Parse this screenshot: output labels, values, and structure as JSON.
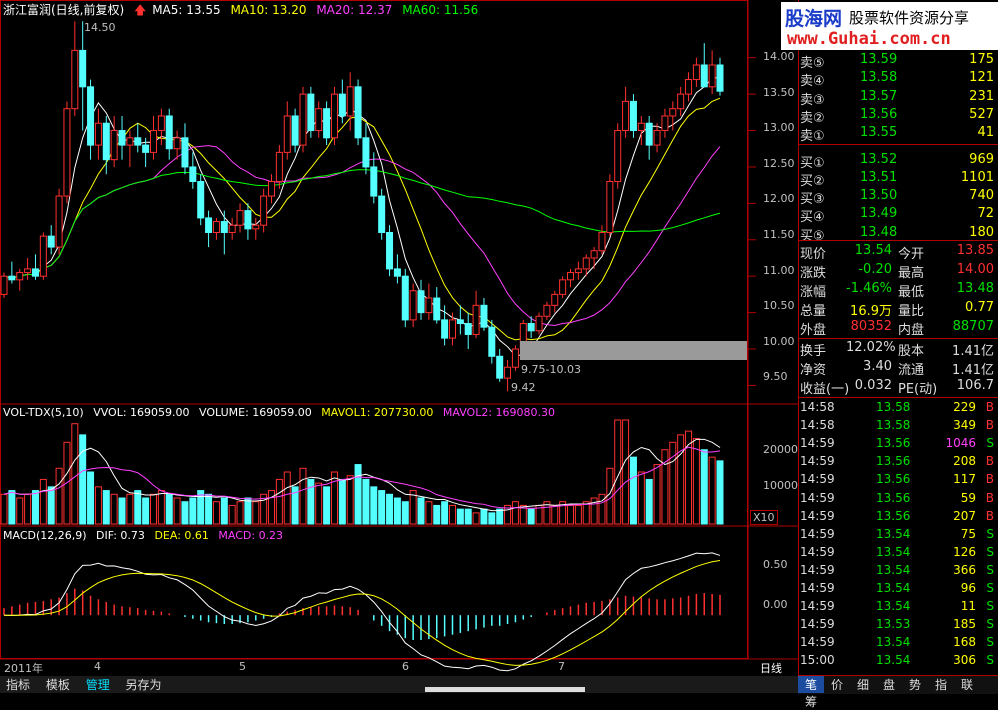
{
  "chart_header": {
    "stock": "浙江富润(日线,前复权)",
    "ma5": "MA5: 13.55",
    "ma10": "MA10: 13.20",
    "ma20": "MA20: 12.37",
    "ma60": "MA60: 11.56"
  },
  "price_annotations": {
    "high": "14.50",
    "low": "9.42",
    "range": "9.75-10.03"
  },
  "price_axis": [
    "14.00",
    "13.50",
    "13.00",
    "12.50",
    "12.00",
    "11.50",
    "11.00",
    "10.50",
    "10.00",
    "9.50"
  ],
  "vol_header": {
    "name": "VOL-TDX(5,10)",
    "vvol": "VVOL: 169059.00",
    "volume": "VOLUME: 169059.00",
    "mavol1": "MAVOL1: 207730.00",
    "mavol2": "MAVOL2: 169080.30"
  },
  "vol_axis": [
    "20000",
    "10000"
  ],
  "vol_unit": "X10",
  "macd_header": {
    "name": "MACD(12,26,9)",
    "dif": "DIF: 0.73",
    "dea": "DEA: 0.61",
    "macd": "MACD: 0.23"
  },
  "macd_axis": [
    "0.50",
    "0.00"
  ],
  "date_axis": [
    "2011年",
    "4",
    "5",
    "6",
    "7"
  ],
  "period_label": "日线",
  "bottom_tabs": [
    "指标",
    "模板",
    "管理",
    "另存为"
  ],
  "bottom_tab_active": 2,
  "watermark": {
    "site": "股海网",
    "slogan": "股票软件资源分享",
    "url": "www.Guhai.com.cn"
  },
  "order_book": {
    "sell": [
      {
        "label": "卖⑤",
        "price": "13.59",
        "vol": "175"
      },
      {
        "label": "卖④",
        "price": "13.58",
        "vol": "121"
      },
      {
        "label": "卖③",
        "price": "13.57",
        "vol": "231"
      },
      {
        "label": "卖②",
        "price": "13.56",
        "vol": "527"
      },
      {
        "label": "卖①",
        "price": "13.55",
        "vol": "41"
      }
    ],
    "buy": [
      {
        "label": "买①",
        "price": "13.52",
        "vol": "969"
      },
      {
        "label": "买②",
        "price": "13.51",
        "vol": "1101"
      },
      {
        "label": "买③",
        "price": "13.50",
        "vol": "740"
      },
      {
        "label": "买④",
        "price": "13.49",
        "vol": "72"
      },
      {
        "label": "买⑤",
        "price": "13.48",
        "vol": "180"
      }
    ]
  },
  "quote": [
    {
      "l1": "现价",
      "v1": "13.54",
      "l2": "今开",
      "v2": "13.85",
      "c1": "#00e000",
      "c2": "#ff3030"
    },
    {
      "l1": "涨跌",
      "v1": "-0.20",
      "l2": "最高",
      "v2": "14.00",
      "c1": "#00e000",
      "c2": "#ff3030"
    },
    {
      "l1": "涨幅",
      "v1": "-1.46%",
      "l2": "最低",
      "v2": "13.48",
      "c1": "#00e000",
      "c2": "#00e000"
    },
    {
      "l1": "总量",
      "v1": "16.9万",
      "l2": "量比",
      "v2": "0.77",
      "c1": "#ffff00",
      "c2": "#ffff00"
    },
    {
      "l1": "外盘",
      "v1": "80352",
      "l2": "内盘",
      "v2": "88707",
      "c1": "#ff3030",
      "c2": "#00e000"
    }
  ],
  "fundamentals": [
    {
      "l1": "换手",
      "v1": "12.02%",
      "l2": "股本",
      "v2": "1.41亿"
    },
    {
      "l1": "净资",
      "v1": "3.40",
      "l2": "流通",
      "v2": "1.41亿"
    },
    {
      "l1": "收益(一)",
      "v1": "0.032",
      "l2": "PE(动)",
      "v2": "106.7"
    }
  ],
  "ticks": [
    {
      "t": "14:58",
      "p": "13.58",
      "v": "229",
      "s": "B"
    },
    {
      "t": "14:58",
      "p": "13.58",
      "v": "349",
      "s": "B"
    },
    {
      "t": "14:59",
      "p": "13.56",
      "v": "1046",
      "s": "S"
    },
    {
      "t": "14:59",
      "p": "13.56",
      "v": "208",
      "s": "B"
    },
    {
      "t": "14:59",
      "p": "13.56",
      "v": "117",
      "s": "B"
    },
    {
      "t": "14:59",
      "p": "13.56",
      "v": "59",
      "s": "B"
    },
    {
      "t": "14:59",
      "p": "13.56",
      "v": "207",
      "s": "B"
    },
    {
      "t": "14:59",
      "p": "13.54",
      "v": "75",
      "s": "S"
    },
    {
      "t": "14:59",
      "p": "13.54",
      "v": "126",
      "s": "S"
    },
    {
      "t": "14:59",
      "p": "13.54",
      "v": "366",
      "s": "S"
    },
    {
      "t": "14:59",
      "p": "13.54",
      "v": "96",
      "s": "S"
    },
    {
      "t": "14:59",
      "p": "13.54",
      "v": "11",
      "s": "S"
    },
    {
      "t": "14:59",
      "p": "13.53",
      "v": "185",
      "s": "S"
    },
    {
      "t": "14:59",
      "p": "13.54",
      "v": "168",
      "s": "S"
    },
    {
      "t": "15:00",
      "p": "13.54",
      "v": "306",
      "s": "S"
    }
  ],
  "bottom_toolbar": [
    "笔",
    "价",
    "细",
    "盘",
    "势",
    "指",
    "联",
    "筹"
  ],
  "bottom_toolbar_active": 0,
  "chart_data": {
    "type": "candlestick",
    "candles": [
      [
        10.75,
        11.05,
        10.7,
        11.0
      ],
      [
        11.0,
        11.2,
        10.9,
        10.95
      ],
      [
        10.95,
        11.1,
        10.8,
        11.05
      ],
      [
        11.05,
        11.25,
        10.95,
        11.1
      ],
      [
        11.1,
        11.3,
        10.95,
        11.0
      ],
      [
        11.0,
        11.6,
        10.95,
        11.55
      ],
      [
        11.55,
        11.7,
        11.3,
        11.4
      ],
      [
        11.4,
        12.2,
        11.3,
        12.1
      ],
      [
        12.1,
        13.4,
        12.0,
        13.3
      ],
      [
        13.3,
        14.5,
        13.2,
        14.1
      ],
      [
        14.1,
        14.5,
        13.0,
        13.6
      ],
      [
        13.6,
        13.7,
        12.6,
        12.8
      ],
      [
        12.8,
        13.3,
        12.6,
        13.1
      ],
      [
        13.1,
        13.2,
        12.4,
        12.6
      ],
      [
        12.6,
        13.2,
        12.5,
        13.0
      ],
      [
        13.0,
        13.2,
        12.6,
        12.8
      ],
      [
        12.8,
        13.0,
        12.5,
        12.9
      ],
      [
        12.9,
        13.1,
        12.7,
        12.8
      ],
      [
        12.8,
        12.9,
        12.5,
        12.7
      ],
      [
        12.7,
        13.2,
        12.6,
        13.0
      ],
      [
        13.0,
        13.3,
        12.8,
        13.2
      ],
      [
        13.2,
        13.3,
        12.6,
        12.75
      ],
      [
        12.75,
        13.0,
        12.6,
        12.9
      ],
      [
        12.9,
        13.1,
        12.4,
        12.5
      ],
      [
        12.5,
        12.7,
        12.2,
        12.3
      ],
      [
        12.3,
        12.4,
        11.7,
        11.8
      ],
      [
        11.8,
        11.9,
        11.4,
        11.6
      ],
      [
        11.6,
        11.8,
        11.5,
        11.75
      ],
      [
        11.75,
        11.9,
        11.3,
        11.6
      ],
      [
        11.6,
        11.8,
        11.5,
        11.7
      ],
      [
        11.7,
        12.0,
        11.6,
        11.9
      ],
      [
        11.9,
        12.0,
        11.5,
        11.65
      ],
      [
        11.65,
        11.8,
        11.5,
        11.7
      ],
      [
        11.7,
        12.2,
        11.6,
        12.1
      ],
      [
        12.1,
        12.4,
        12.0,
        12.3
      ],
      [
        12.3,
        12.8,
        12.2,
        12.7
      ],
      [
        12.7,
        13.4,
        12.6,
        13.2
      ],
      [
        13.2,
        13.3,
        12.7,
        12.8
      ],
      [
        12.8,
        13.6,
        12.7,
        13.5
      ],
      [
        13.5,
        13.6,
        12.9,
        13.0
      ],
      [
        13.0,
        13.4,
        12.9,
        13.3
      ],
      [
        13.3,
        13.4,
        12.8,
        12.9
      ],
      [
        12.9,
        13.6,
        12.8,
        13.5
      ],
      [
        13.5,
        13.7,
        13.1,
        13.2
      ],
      [
        13.2,
        13.8,
        13.0,
        13.6
      ],
      [
        13.6,
        13.7,
        12.8,
        12.9
      ],
      [
        12.9,
        13.1,
        12.4,
        12.5
      ],
      [
        12.5,
        12.7,
        12.0,
        12.1
      ],
      [
        12.1,
        12.2,
        11.5,
        11.6
      ],
      [
        11.6,
        11.7,
        11.0,
        11.1
      ],
      [
        11.1,
        11.3,
        10.9,
        11.0
      ],
      [
        11.0,
        11.1,
        10.3,
        10.4
      ],
      [
        10.4,
        10.9,
        10.3,
        10.8
      ],
      [
        10.8,
        10.95,
        10.4,
        10.5
      ],
      [
        10.5,
        10.9,
        10.4,
        10.7
      ],
      [
        10.7,
        10.85,
        10.35,
        10.4
      ],
      [
        10.4,
        10.6,
        10.05,
        10.15
      ],
      [
        10.15,
        10.5,
        10.05,
        10.4
      ],
      [
        10.4,
        10.6,
        10.2,
        10.35
      ],
      [
        10.35,
        10.5,
        10.0,
        10.2
      ],
      [
        10.2,
        10.8,
        10.15,
        10.6
      ],
      [
        10.6,
        10.7,
        10.25,
        10.3
      ],
      [
        10.3,
        10.4,
        9.8,
        9.9
      ],
      [
        9.9,
        10.0,
        9.55,
        9.6
      ],
      [
        9.6,
        9.85,
        9.42,
        9.75
      ],
      [
        9.75,
        10.05,
        9.7,
        10.0
      ],
      [
        10.0,
        10.4,
        9.95,
        10.35
      ],
      [
        10.35,
        10.45,
        10.15,
        10.25
      ],
      [
        10.25,
        10.5,
        10.2,
        10.45
      ],
      [
        10.45,
        10.65,
        10.4,
        10.6
      ],
      [
        10.6,
        10.8,
        10.5,
        10.75
      ],
      [
        10.75,
        11.0,
        10.7,
        10.95
      ],
      [
        10.95,
        11.1,
        10.85,
        11.05
      ],
      [
        11.05,
        11.2,
        10.95,
        11.1
      ],
      [
        11.1,
        11.3,
        11.0,
        11.25
      ],
      [
        11.25,
        11.4,
        11.1,
        11.35
      ],
      [
        11.35,
        11.7,
        11.3,
        11.6
      ],
      [
        11.6,
        12.4,
        11.55,
        12.3
      ],
      [
        12.3,
        13.1,
        12.2,
        13.0
      ],
      [
        13.0,
        13.6,
        12.9,
        13.4
      ],
      [
        13.4,
        13.5,
        12.9,
        13.0
      ],
      [
        13.0,
        13.2,
        12.8,
        13.1
      ],
      [
        13.1,
        13.2,
        12.6,
        12.8
      ],
      [
        12.8,
        13.1,
        12.7,
        13.0
      ],
      [
        13.0,
        13.3,
        12.9,
        13.2
      ],
      [
        13.2,
        13.4,
        13.0,
        13.3
      ],
      [
        13.3,
        13.6,
        13.2,
        13.5
      ],
      [
        13.5,
        13.8,
        13.4,
        13.7
      ],
      [
        13.7,
        14.0,
        13.6,
        13.9
      ],
      [
        13.9,
        14.2,
        13.7,
        13.6
      ],
      [
        13.6,
        14.1,
        13.5,
        13.9
      ],
      [
        13.9,
        14.0,
        13.48,
        13.54
      ]
    ],
    "volume": [
      8,
      9,
      7,
      8,
      9,
      12,
      10,
      15,
      22,
      27,
      24,
      14,
      10,
      9,
      8,
      7,
      8,
      9,
      7,
      8,
      9,
      8,
      7,
      6,
      7,
      9,
      8,
      6,
      7,
      5,
      6,
      7,
      6,
      8,
      9,
      12,
      14,
      10,
      15,
      12,
      11,
      10,
      14,
      12,
      13,
      16,
      12,
      10,
      9,
      8,
      7,
      6,
      9,
      7,
      6,
      5,
      6,
      5,
      4,
      4,
      3,
      4,
      3,
      4,
      5,
      6,
      5,
      4,
      5,
      6,
      5,
      6,
      5,
      5,
      6,
      7,
      8,
      15,
      28,
      28,
      18,
      14,
      12,
      16,
      20,
      22,
      24,
      25,
      23,
      20,
      18,
      17
    ],
    "macd_hist": [
      0.08,
      0.1,
      0.12,
      0.14,
      0.15,
      0.16,
      0.18,
      0.2,
      0.25,
      0.3,
      0.28,
      0.22,
      0.18,
      0.15,
      0.12,
      0.1,
      0.09,
      0.08,
      0.06,
      0.05,
      0.04,
      0.02,
      0.0,
      -0.02,
      -0.04,
      -0.06,
      -0.08,
      -0.09,
      -0.1,
      -0.1,
      -0.09,
      -0.08,
      -0.06,
      -0.04,
      -0.02,
      0.02,
      0.04,
      0.06,
      0.08,
      0.09,
      0.1,
      0.1,
      0.11,
      0.1,
      0.09,
      0.06,
      0.0,
      -0.06,
      -0.12,
      -0.18,
      -0.22,
      -0.26,
      -0.28,
      -0.28,
      -0.27,
      -0.26,
      -0.24,
      -0.22,
      -0.2,
      -0.18,
      -0.16,
      -0.14,
      -0.12,
      -0.12,
      -0.1,
      -0.08,
      -0.05,
      -0.02,
      0.0,
      0.03,
      0.06,
      0.08,
      0.1,
      0.12,
      0.14,
      0.15,
      0.16,
      0.18,
      0.2,
      0.22,
      0.21,
      0.2,
      0.19,
      0.18,
      0.18,
      0.19,
      0.2,
      0.22,
      0.24,
      0.25,
      0.24,
      0.23
    ],
    "ylim": [
      9.3,
      14.6
    ],
    "vol_max": 28,
    "macd_ylim": [
      -0.45,
      0.85
    ]
  },
  "colors": {
    "up": "#ff3030",
    "down": "#54ffff",
    "ma5": "#ffffff",
    "ma10": "#ffff00",
    "ma20": "#ff40ff",
    "ma60": "#00ff00",
    "border": "#b00000"
  }
}
